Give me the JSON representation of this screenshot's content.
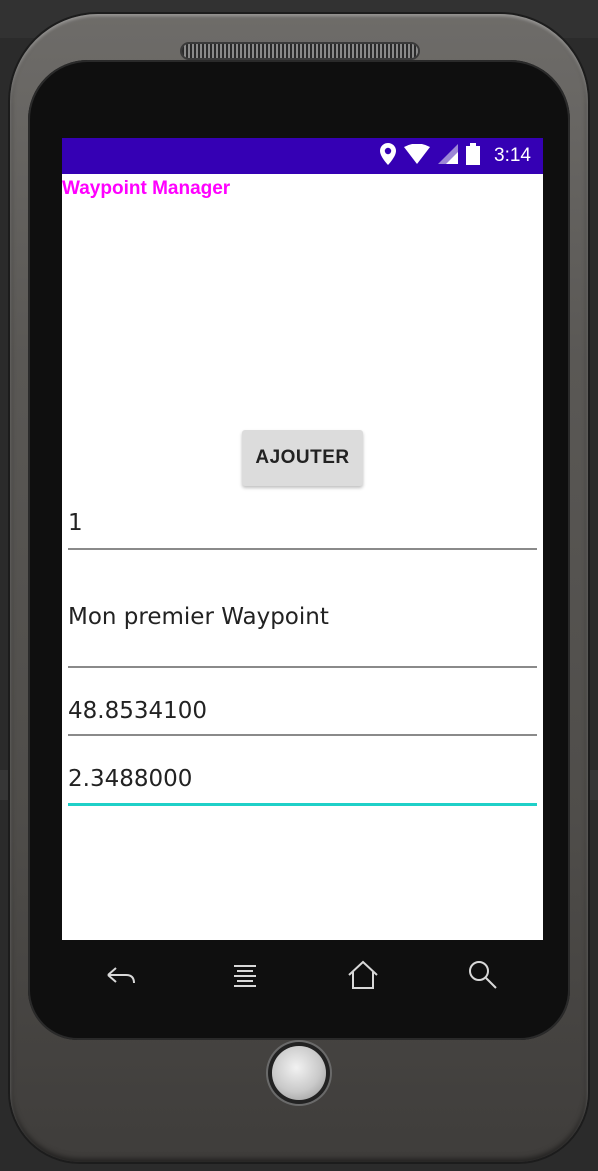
{
  "status_bar": {
    "time": "3:14",
    "icons": [
      "location-icon",
      "wifi-icon",
      "cell-signal-icon",
      "battery-icon"
    ],
    "background": "#3500b4"
  },
  "app": {
    "title": "Waypoint Manager",
    "title_color": "#ff00ff"
  },
  "form": {
    "add_button_label": "AJOUTER",
    "id_value": "1",
    "name_value": "Mon premier Waypoint",
    "latitude_value": "48.8534100",
    "longitude_value": "2.3488000",
    "focus_accent": "#1fd0c8"
  },
  "nav_bar": {
    "icons": [
      "back-icon",
      "menu-icon",
      "home-icon",
      "search-icon"
    ]
  }
}
